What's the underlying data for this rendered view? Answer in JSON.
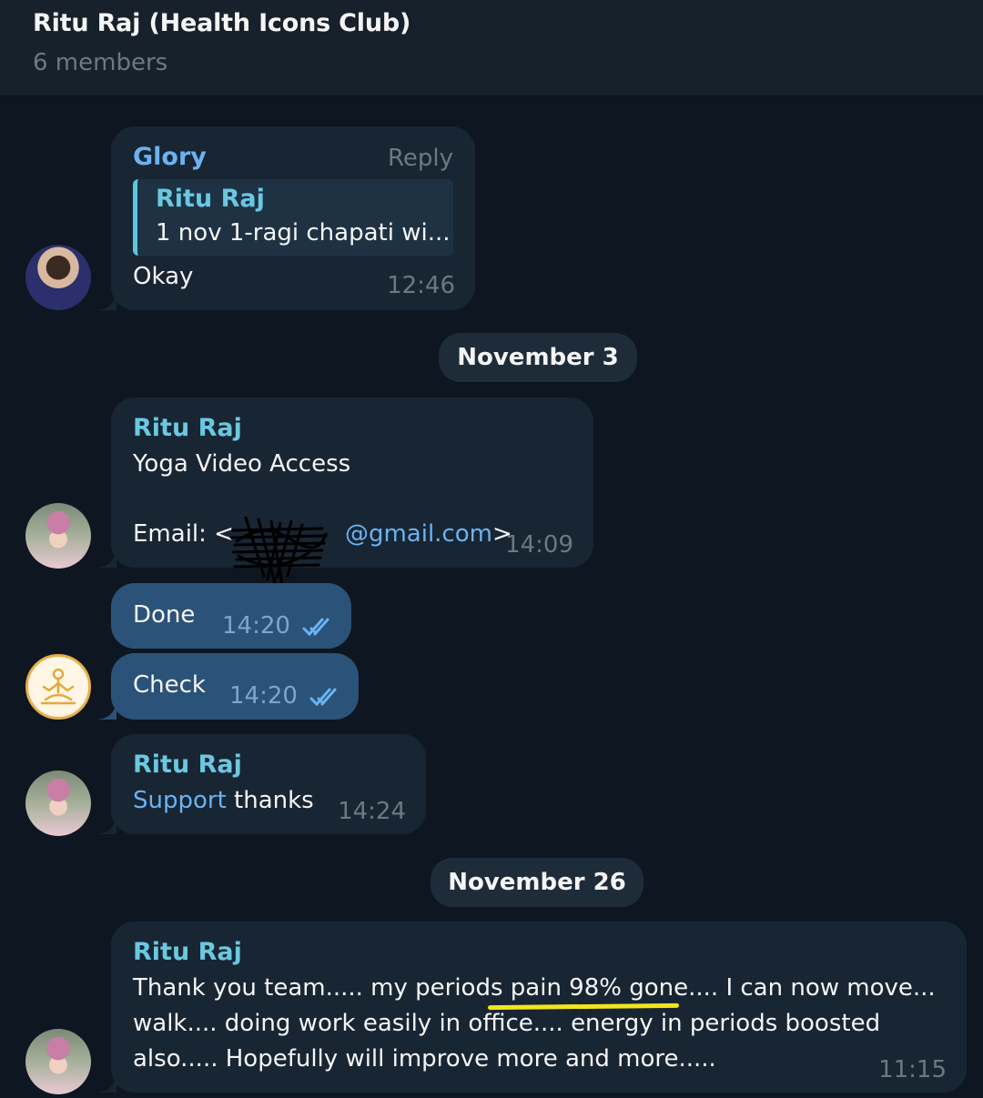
{
  "header": {
    "title": "Ritu Raj (Health Icons Club)",
    "members": "6 members"
  },
  "messages": {
    "m1": {
      "sender": "Glory",
      "reply_label": "Reply",
      "quote_sender": "Ritu Raj",
      "quote_text": "1 nov 1-ragi chapati wi...",
      "text": "Okay",
      "time": "12:46"
    },
    "date1": "November 3",
    "m2": {
      "sender": "Ritu Raj",
      "line1": "Yoga Video Access",
      "email_prefix": "Email: <",
      "email_domain": "@gmail.com",
      "email_suffix": ">",
      "time": "14:09"
    },
    "m3": {
      "text": "Done",
      "time": "14:20"
    },
    "m4": {
      "text": "Check",
      "time": "14:20"
    },
    "m5": {
      "sender": "Ritu Raj",
      "link": "Support",
      "text": " thanks",
      "time": "14:24"
    },
    "date2": "November 26",
    "m6": {
      "sender": "Ritu Raj",
      "line1": "Thank you team..... my periods pain 98% gone.... I can now move...",
      "line2": "walk.... doing work easily in office.... energy in periods boosted",
      "line3": "also..... Hopefully will improve more and more.....",
      "time": "11:15"
    }
  },
  "colors": {
    "background": "#0e1621",
    "bubble_in": "#182533",
    "bubble_out": "#2b5278",
    "sender_name": "#6ac8e0",
    "highlight": "#f2e51c"
  },
  "icons": {
    "read_receipt": "double-check-icon",
    "yoga_avatar": "meditation-icon"
  }
}
